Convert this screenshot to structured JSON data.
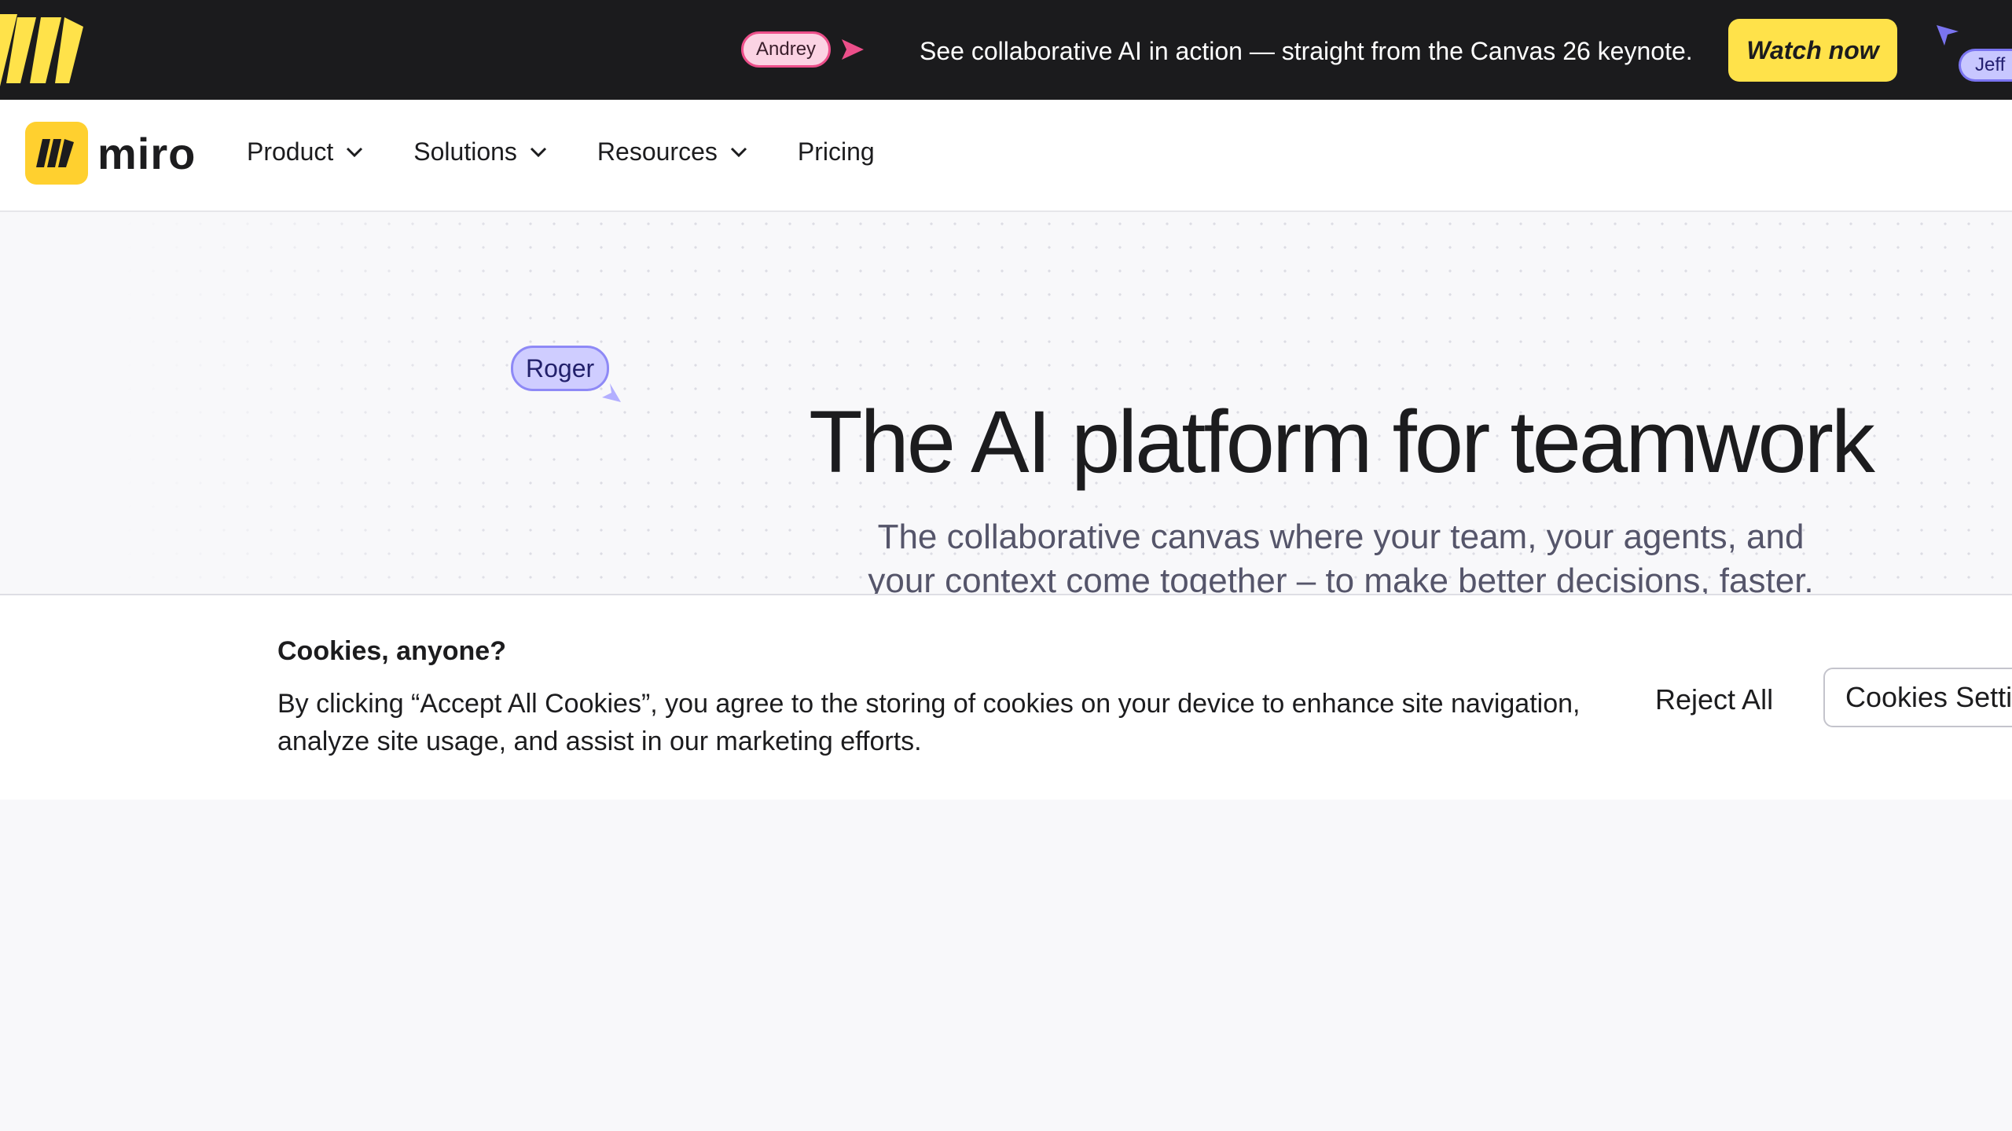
{
  "promo": {
    "cursor_andrey": "Andrey",
    "text": "See collaborative AI in action — straight from the Canvas 26 keynote.",
    "watch_label": "Watch now",
    "cursor_jeff": "Jeff"
  },
  "nav": {
    "brand": "miro",
    "items": [
      {
        "label": "Product",
        "has_menu": true
      },
      {
        "label": "Solutions",
        "has_menu": true
      },
      {
        "label": "Resources",
        "has_menu": true
      },
      {
        "label": "Pricing",
        "has_menu": false
      }
    ]
  },
  "hero": {
    "cursor_roger": "Roger",
    "headline": "The AI platform for teamwork",
    "subhead_line1": "The collaborative canvas where your team, your agents, and",
    "subhead_line2": "your context come together – to make better decisions, faster."
  },
  "cookie": {
    "title": "Cookies, anyone?",
    "body": "By clicking “Accept All Cookies”, you agree to the storing of cookies on your device to enhance site navigation, analyze site usage, and assist in our marketing efforts.",
    "reject_label": "Reject All",
    "settings_label": "Cookies Settings"
  },
  "colors": {
    "promo_bg": "#1b1b1d",
    "brand_yellow": "#ffd02f",
    "watch_button": "#ffe24a",
    "andrey_pink": "#ec4f8a",
    "roger_purple": "#8e89f6",
    "jeff_purple": "#7a74f0"
  },
  "icons": {
    "promo_logo": "miro-logo-icon",
    "chevron": "chevron-down-icon",
    "cursor": "pointer-cursor-icon"
  }
}
